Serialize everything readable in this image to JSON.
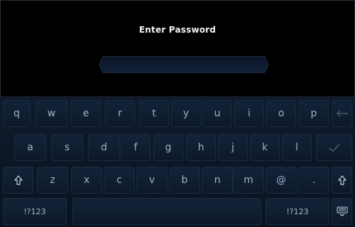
{
  "title": "Enter Password",
  "password": {
    "value": "",
    "placeholder": ""
  },
  "keyboard": {
    "row1": [
      "q",
      "w",
      "e",
      "r",
      "t",
      "y",
      "u",
      "i",
      "o",
      "p"
    ],
    "row2": [
      "a",
      "s",
      "d",
      "f",
      "g",
      "h",
      "j",
      "k",
      "l"
    ],
    "row3": [
      "z",
      "x",
      "c",
      "v",
      "b",
      "n",
      "m",
      "@",
      "."
    ],
    "bottom": {
      "left_label": "!?123",
      "right_label": "!?123"
    },
    "icons": {
      "backspace": "backspace-icon",
      "enter": "checkmark-icon",
      "shift": "shift-icon",
      "hide": "keyboard-hide-icon"
    }
  }
}
